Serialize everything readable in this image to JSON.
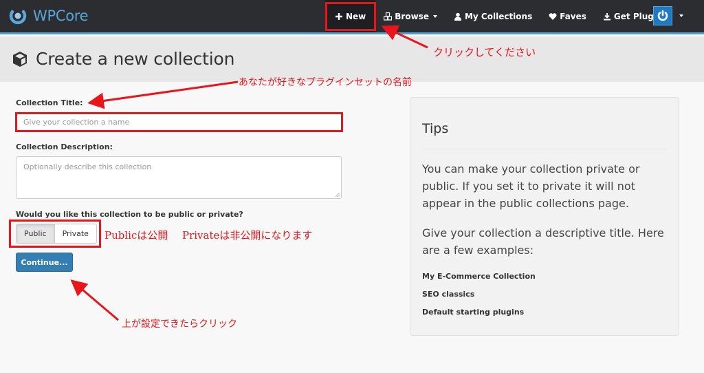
{
  "navbar": {
    "brand": "WPCore",
    "items": [
      {
        "label": "New",
        "icon": "plus-icon",
        "active": true
      },
      {
        "label": "Browse",
        "icon": "cubes-icon",
        "dropdown": true
      },
      {
        "label": "My Collections",
        "icon": "user-icon"
      },
      {
        "label": "Faves",
        "icon": "heart-icon"
      },
      {
        "label": "Get Plugin",
        "icon": "download-icon"
      }
    ],
    "user_icon": "power-icon"
  },
  "page": {
    "title": "Create a new collection",
    "title_icon": "cube-icon"
  },
  "form": {
    "title_label": "Collection Title:",
    "title_value": "",
    "title_placeholder": "Give your collection a name",
    "description_label": "Collection Description:",
    "description_value": "",
    "description_placeholder": "Optionally describe this collection",
    "visibility_label": "Would you like this collection to be public or private?",
    "visibility_options": [
      "Public",
      "Private"
    ],
    "visibility_selected": "Public",
    "continue_label": "Continue..."
  },
  "tips": {
    "title": "Tips",
    "paragraphs": [
      "You can make your collection private or public. If you set it to private it will not appear in the public collections page.",
      "Give your collection a descriptive title. Here are a few examples:"
    ],
    "examples": [
      "My E-Commerce Collection",
      "SEO classics",
      "Default starting plugins"
    ]
  },
  "annotations": {
    "click_here": "クリックしてください",
    "title_hint": "あなたが好きなプラグインセットの名前",
    "visibility_hint_public": "Publicは公開",
    "visibility_hint_private": "Privateは非公開になります",
    "continue_hint": "上が設定できたらクリック",
    "color": "#e8161b"
  },
  "colors": {
    "navbar_bg": "#2b2d31",
    "brand": "#58a6da",
    "accent_border": "#4f9fd2",
    "primary_button": "#337fb3"
  }
}
